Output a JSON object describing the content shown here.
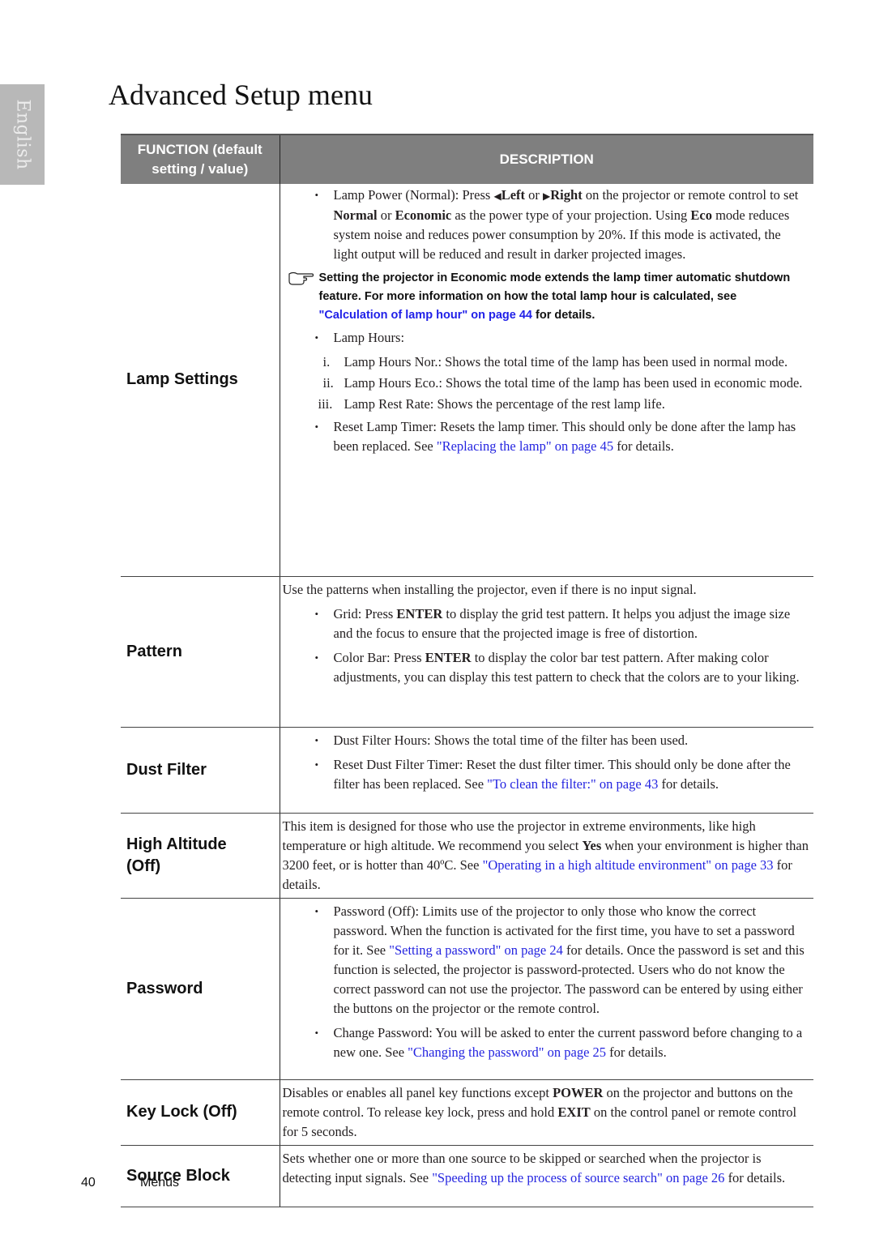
{
  "side_tab": {
    "label": "English"
  },
  "page": {
    "title": "Advanced Setup menu"
  },
  "table": {
    "headers": {
      "function_line1": "FUNCTION (default",
      "function_line2": "setting / value)",
      "description": "DESCRIPTION"
    },
    "rows": {
      "lamp": {
        "function": "Lamp Settings",
        "lamp_power": {
          "t1": "Lamp Power (Normal): Press ",
          "left_icon": "◀",
          "left": "Left",
          "t2": " or ",
          "right_icon": "▶",
          "right": "Right",
          "t3": " on the  projector or remote control to set ",
          "normal": "Normal",
          "t4": " or ",
          "economic": "Economic",
          "t5": " as the power type of your projection. Using ",
          "eco": "Eco",
          "t6": " mode reduces system noise and reduces power consumption by 20%. If this mode is activated, the light output will be reduced and result in darker projected images."
        },
        "note": {
          "icon": "pointing-hand-icon",
          "t1": "Setting the projector in Economic mode extends the lamp timer automatic shutdown feature. For more information on how the total lamp hour is calculated, see ",
          "link": "\"Calculation of lamp hour\" on page 44",
          "t2": " for details."
        },
        "lamp_hours": "Lamp Hours:",
        "sub_items": [
          {
            "num": "i.",
            "text": "Lamp Hours Nor.: Shows the total time of the lamp has been used in normal mode."
          },
          {
            "num": "ii.",
            "text": "Lamp Hours Eco.: Shows the total time of the lamp has been used in economic mode."
          },
          {
            "num": "iii.",
            "text": "Lamp Rest Rate: Shows the percentage of the rest lamp life."
          }
        ],
        "reset": {
          "t1": "Reset Lamp Timer: Resets the lamp timer. This should only be done after the lamp has been replaced. See ",
          "link": "\"Replacing the lamp\" on page 45",
          "t2": " for details."
        }
      },
      "pattern": {
        "function": "Pattern",
        "intro": "Use the patterns when installing the projector, even if there is no input signal.",
        "grid": {
          "t1": "Grid: Press ",
          "key": "ENTER",
          "t2": " to display the grid test pattern. It helps you adjust the image size and the focus to ensure that the projected image is free of distortion."
        },
        "color_bar": {
          "t1": "Color Bar: Press ",
          "key": "ENTER",
          "t2": " to display the color bar test pattern. After making color adjustments, you can display this test pattern to check that the colors are to your liking."
        }
      },
      "dust_filter": {
        "function": "Dust Filter",
        "hours": "Dust Filter Hours: Shows the total time of the filter has been used.",
        "reset": {
          "t1": "Reset Dust Filter Timer: Reset the dust filter timer. This should only be done after the filter has been replaced. See ",
          "link": "\"To clean the filter:\" on page 43",
          "t2": " for details."
        }
      },
      "high_altitude": {
        "function_line1": "High Altitude",
        "function_line2": "(Off)",
        "t1": "This item is designed for those who use the projector in extreme environments, like high temperature or high altitude. We recommend you select ",
        "yes": "Yes",
        "t2": " when your environment is higher than 3200 feet, or is hotter than 40ºC. See ",
        "link": "\"Operating in a high altitude environment\" on page 33",
        "t3": " for details."
      },
      "password": {
        "function": "Password",
        "pw": {
          "t1": "Password (Off): Limits use of the projector to only those who know the correct password. When the function is activated for the first time, you have to set a password for it. See ",
          "link": "\"Setting a password\" on page 24",
          "t2": " for details. Once the password is set and this function is selected, the projector is password-protected. Users who do not know the correct password can not use the projector. The password can be entered by using either the buttons on the projector or the remote control."
        },
        "change": {
          "t1": "Change Password: You will be asked to enter the current password before changing to a new one. See ",
          "link": "\"Changing the password\" on page 25",
          "t2": " for details."
        }
      },
      "key_lock": {
        "function": "Key Lock (Off)",
        "t1": "Disables or enables all panel key functions except ",
        "power": "POWER",
        "t2": " on the projector and buttons on the remote control. To release key lock, press and hold ",
        "exit": "EXIT",
        "t3": " on the control panel or remote control for 5 seconds."
      },
      "source_block": {
        "function": "Source Block",
        "t1": "Sets whether one or more than one source to be skipped or searched when the projector is detecting input signals. See ",
        "link": "\"Speeding up the process of source search\" on page 26",
        "t2": " for details."
      }
    }
  },
  "footer": {
    "page_number": "40",
    "section": "Menus"
  },
  "colors": {
    "header_bg": "#7f7f7f",
    "side_tab_bg": "#b8b8b8",
    "link": "#2424e0"
  }
}
